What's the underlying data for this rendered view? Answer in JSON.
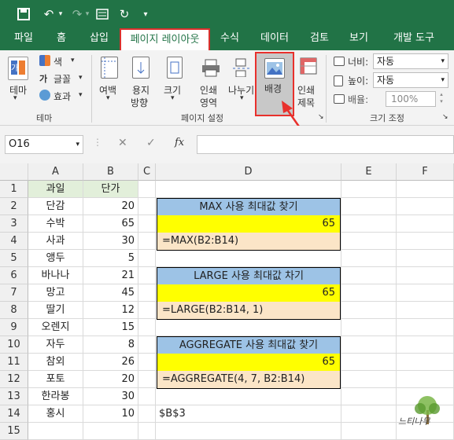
{
  "ribbon_tabs": [
    "파일",
    "홈",
    "삽입",
    "페이지 레이아웃",
    "수식",
    "데이터",
    "검토",
    "보기",
    "개발 도구"
  ],
  "ribbon": {
    "theme_group": {
      "theme_btn": "테마",
      "colors": "색",
      "fonts": "글꼴",
      "effects": "효과",
      "group_label": "테마"
    },
    "page_setup": {
      "margins_l1": "여백",
      "size_orient_l1": "용지",
      "size_orient_l2": "방향",
      "size_l1": "크기",
      "print_area_l1": "인쇄",
      "print_area_l2": "영역",
      "breaks_l1": "나누기",
      "background_l1": "배경",
      "print_titles_l1": "인쇄",
      "print_titles_l2": "제목",
      "group_label": "페이지 설정"
    },
    "scale": {
      "width_label": "너비:",
      "width_value": "자동",
      "height_label": "높이:",
      "height_value": "자동",
      "scale_label": "배율:",
      "scale_value": "100%",
      "group_label": "크기 조정"
    }
  },
  "formula_bar": {
    "name_box": "O16",
    "cancel": "✕",
    "enter": "✓",
    "fx": "fx",
    "content": ""
  },
  "columns": [
    "A",
    "B",
    "C",
    "D",
    "E",
    "F"
  ],
  "rows": [
    "1",
    "2",
    "3",
    "4",
    "5",
    "6",
    "7",
    "8",
    "9",
    "10",
    "11",
    "12",
    "13",
    "14",
    "15"
  ],
  "table": {
    "header": {
      "fruit": "과일",
      "price": "단가"
    },
    "items": [
      {
        "fruit": "단감",
        "price": "20"
      },
      {
        "fruit": "수박",
        "price": "65"
      },
      {
        "fruit": "사과",
        "price": "30"
      },
      {
        "fruit": "앵두",
        "price": "5"
      },
      {
        "fruit": "바나나",
        "price": "21"
      },
      {
        "fruit": "망고",
        "price": "45"
      },
      {
        "fruit": "딸기",
        "price": "12"
      },
      {
        "fruit": "오렌지",
        "price": "15"
      },
      {
        "fruit": "자두",
        "price": "8"
      },
      {
        "fruit": "참외",
        "price": "26"
      },
      {
        "fruit": "포토",
        "price": "20"
      },
      {
        "fruit": "한라봉",
        "price": "30"
      },
      {
        "fruit": "홍시",
        "price": "10"
      }
    ]
  },
  "panels": [
    {
      "title": "MAX 사용 최대값 찾기",
      "result": "65",
      "formula": "=MAX(B2:B14)"
    },
    {
      "title": "LARGE 사용 최대값 차기",
      "result": "65",
      "formula": "=LARGE(B2:B14, 1)"
    },
    {
      "title": "AGGREGATE 사용 최대값 찾기",
      "result": "65",
      "formula": "=AGGREGATE(4, 7, B2:B14)"
    }
  ],
  "d14": "$B$3",
  "watermark": "느티나무",
  "colors": {
    "excel_green": "#217346",
    "panel_title": "#9dc3e6",
    "panel_result": "#ffff00",
    "panel_formula": "#fbe5c7",
    "highlight": "#e8302c"
  }
}
